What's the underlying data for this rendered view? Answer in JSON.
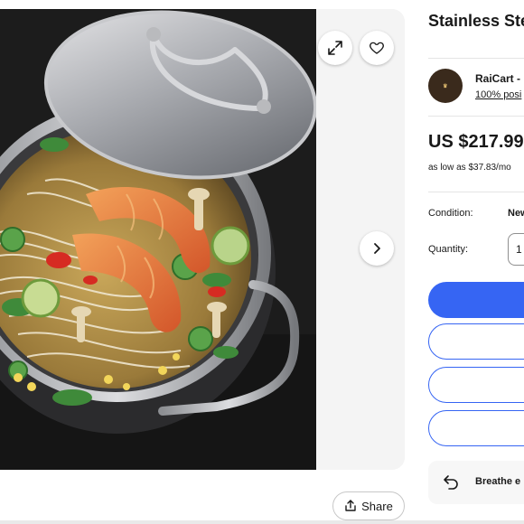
{
  "product": {
    "title": "Stainless Ste Lid",
    "price": "US $217.99",
    "monthly": "as low as $37.83/mo"
  },
  "seller": {
    "name": "RaiCart -",
    "feedback": "100% posi"
  },
  "details": {
    "condition_label": "Condition:",
    "condition_value": "New",
    "quantity_label": "Quantity:",
    "quantity_value": "1"
  },
  "returns": {
    "text": "Breathe e"
  },
  "gallery": {
    "share_label": "Share",
    "icons": [
      "expand-icon",
      "heart-icon",
      "chevron-right-icon",
      "share-icon",
      "return-icon"
    ]
  },
  "colors": {
    "accent": "#3665f3",
    "text": "#191919",
    "panel": "#f2f2f2"
  }
}
